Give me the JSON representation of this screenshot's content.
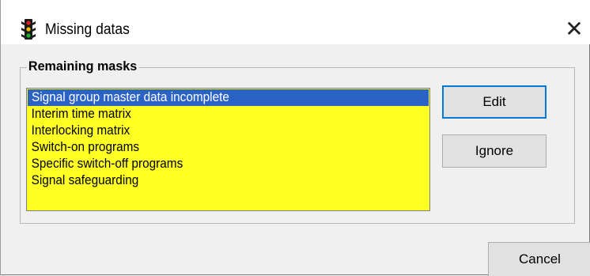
{
  "window": {
    "title": "Missing datas",
    "icon": "traffic-light-icon",
    "close_glyph": "✕"
  },
  "group": {
    "label": "Remaining masks",
    "items": [
      {
        "label": "Signal group master data incomplete",
        "selected": true
      },
      {
        "label": "Interim time matrix",
        "selected": false
      },
      {
        "label": "Interlocking matrix",
        "selected": false
      },
      {
        "label": "Switch-on programs",
        "selected": false
      },
      {
        "label": "Specific switch-off programs",
        "selected": false
      },
      {
        "label": "Signal safeguarding",
        "selected": false
      }
    ]
  },
  "buttons": {
    "edit": "Edit",
    "ignore": "Ignore",
    "cancel": "Cancel"
  },
  "colors": {
    "list_background": "#ffff24",
    "selection": "#2a62c6",
    "default_button_border": "#0078d7"
  }
}
